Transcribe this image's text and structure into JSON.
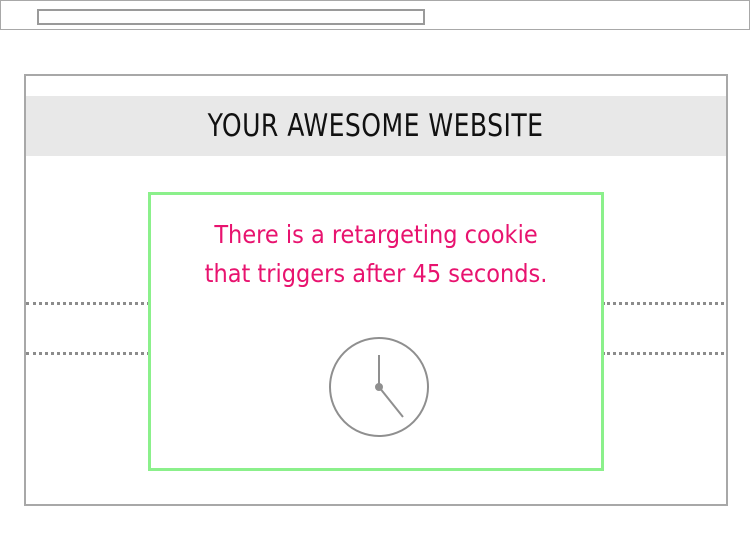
{
  "header": {
    "title": "YOUR AWESOME WEBSITE"
  },
  "popup": {
    "line1": "There is a retargeting cookie",
    "line2": "that triggers after 45 seconds.",
    "icon": "clock-icon"
  },
  "colors": {
    "popup_border": "#8bf08b",
    "popup_text": "#e8136f",
    "header_bg": "#e8e8e8"
  }
}
